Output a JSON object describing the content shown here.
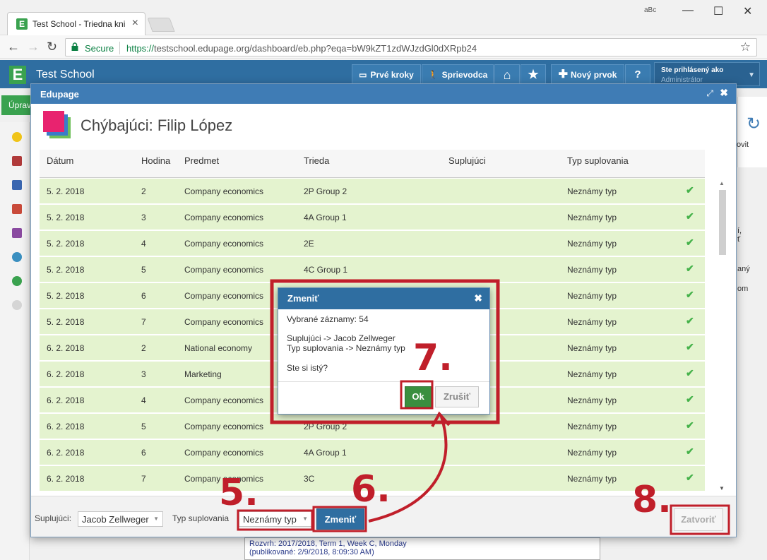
{
  "browser": {
    "tab_title": "Test School - Triedna kni",
    "secure_label": "Secure",
    "url_scheme": "https://",
    "url_rest": "testschool.edupage.org/dashboard/eb.php?eqa=bW9kZT1zdWJzdGl0dXRpb24",
    "extension_label": "aBc"
  },
  "app": {
    "title": "Test School",
    "header_buttons": [
      "Prvé kroky",
      "Sprievodca",
      "Nový prvok",
      "?"
    ],
    "user_line1": "Ste prihlásený ako",
    "user_line2": "Administrátor"
  },
  "background": {
    "edit_button": "Úprav",
    "right_snip1": "ovit",
    "right_snip2": "í,",
    "right_snip3": "ť",
    "right_snip4": "aný",
    "right_snip5": "om",
    "note_line1": "Rozvrh: 2017/2018, Term 1, Week C, Monday",
    "note_line2": "(publikované: 2/9/2018, 8:09:30 AM)"
  },
  "dialog": {
    "title": "Edupage",
    "absent_title": "Chýbajúci: Filip López",
    "columns": [
      "Dátum",
      "Hodina",
      "Predmet",
      "Trieda",
      "Suplujúci",
      "Typ suplovania"
    ],
    "rows": [
      {
        "date": "5. 2. 2018",
        "hour": "2",
        "subject": "Company economics",
        "class": "2P Group 2",
        "sub": "",
        "type": "Neznámy typ"
      },
      {
        "date": "5. 2. 2018",
        "hour": "3",
        "subject": "Company economics",
        "class": "4A Group 1",
        "sub": "",
        "type": "Neznámy typ"
      },
      {
        "date": "5. 2. 2018",
        "hour": "4",
        "subject": "Company economics",
        "class": "2E",
        "sub": "",
        "type": "Neznámy typ"
      },
      {
        "date": "5. 2. 2018",
        "hour": "5",
        "subject": "Company economics",
        "class": "4C Group 1",
        "sub": "",
        "type": "Neznámy typ"
      },
      {
        "date": "5. 2. 2018",
        "hour": "6",
        "subject": "Company economics",
        "class": "",
        "sub": "",
        "type": "Neznámy typ"
      },
      {
        "date": "5. 2. 2018",
        "hour": "7",
        "subject": "Company economics",
        "class": "",
        "sub": "",
        "type": "Neznámy typ"
      },
      {
        "date": "6. 2. 2018",
        "hour": "2",
        "subject": "National economy",
        "class": "",
        "sub": "",
        "type": "Neznámy typ"
      },
      {
        "date": "6. 2. 2018",
        "hour": "3",
        "subject": "Marketing",
        "class": "",
        "sub": "",
        "type": "Neznámy typ"
      },
      {
        "date": "6. 2. 2018",
        "hour": "4",
        "subject": "Company economics",
        "class": "",
        "sub": "",
        "type": "Neznámy typ"
      },
      {
        "date": "6. 2. 2018",
        "hour": "5",
        "subject": "Company economics",
        "class": "2P Group 2",
        "sub": "",
        "type": "Neznámy typ"
      },
      {
        "date": "6. 2. 2018",
        "hour": "6",
        "subject": "Company economics",
        "class": "4A Group 1",
        "sub": "",
        "type": "Neznámy typ"
      },
      {
        "date": "6. 2. 2018",
        "hour": "7",
        "subject": "Company economics",
        "class": "3C",
        "sub": "",
        "type": "Neznámy typ"
      }
    ],
    "footer": {
      "sub_label": "Suplujúci:",
      "sub_value": "Jacob Zellweger",
      "type_label": "Typ suplovania",
      "type_value": "Neznámy typ",
      "change_button": "Zmeniť",
      "close_button": "Zatvoriť"
    }
  },
  "confirm": {
    "title": "Zmeniť",
    "selected": "Vybrané záznamy: 54",
    "line_sub": "Suplujúci -> Jacob Zellweger",
    "line_type": "Typ suplovania -> Neznámy typ",
    "question": "Ste si istý?",
    "ok": "Ok",
    "cancel": "Zrušiť"
  },
  "annotations": {
    "step5": "5.",
    "step6": "6.",
    "step7": "7.",
    "step8": "8.",
    "color": "#c01f2a"
  },
  "icons": {
    "check": "✔",
    "close": "✖",
    "expand": "⤢",
    "home": "⌂",
    "star": "★"
  }
}
